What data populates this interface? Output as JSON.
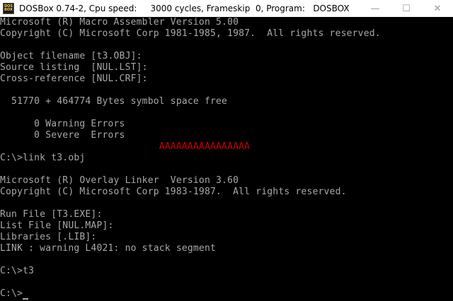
{
  "window": {
    "title": "DOSBox 0.74-2, Cpu speed:     3000 cycles, Frameskip  0, Program:   DOSBOX",
    "icon_text_top": "DOS",
    "icon_text_bottom": "BOX",
    "icon": "dosbox-icon",
    "minimize_glyph": "—",
    "maximize_glyph": "☐",
    "close_glyph": "✕"
  },
  "console": {
    "lines": [
      "Microsoft (R) Macro Assembler Version 5.00",
      "Copyright (C) Microsoft Corp 1981-1985, 1987.  All rights reserved.",
      "",
      "Object filename [t3.OBJ]:",
      "Source listing  [NUL.LST]:",
      "Cross-reference [NUL.CRF]:",
      "",
      "  51770 + 464774 Bytes symbol space free",
      "",
      "      0 Warning Errors",
      "      0 Severe  Errors",
      "                            AAAAAAAAAAAAAAAA",
      "C:\\>link t3.obj",
      "",
      "Microsoft (R) Overlay Linker  Version 3.60",
      "Copyright (C) Microsoft Corp 1983-1987.  All rights reserved.",
      "",
      "Run File [T3.EXE]:",
      "List File [NUL.MAP]:",
      "Libraries [.LIB]:",
      "LINK : warning L4021: no stack segment",
      "",
      "C:\\>t3",
      "",
      "C:\\>"
    ],
    "red_line_index": 11,
    "colors": {
      "background": "#000000",
      "text": "#a8a8a8",
      "highlight": "#c80000"
    }
  }
}
